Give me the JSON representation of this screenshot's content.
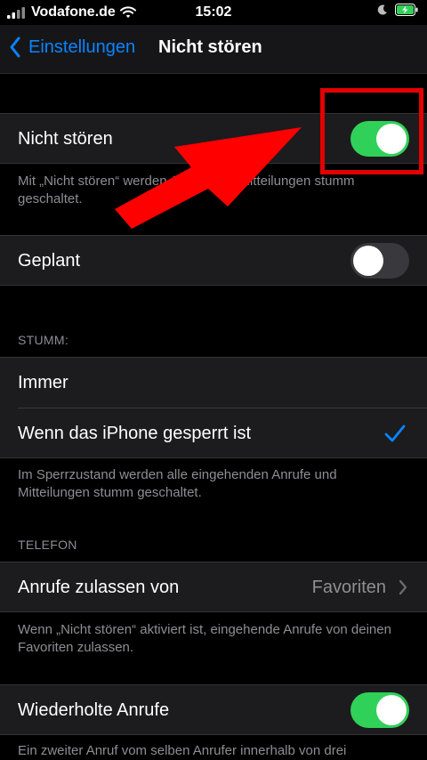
{
  "status_bar": {
    "carrier": "Vodafone.de",
    "time": "15:02"
  },
  "nav": {
    "back_label": "Einstellungen",
    "title": "Nicht stören"
  },
  "dnd": {
    "label": "Nicht stören",
    "enabled": true,
    "footer": "Mit „Nicht stören“ werden Anrufe und Mitteilungen stumm geschaltet."
  },
  "scheduled": {
    "label": "Geplant",
    "enabled": false
  },
  "silence": {
    "header": "STUMM:",
    "options": [
      "Immer",
      "Wenn das iPhone gesperrt ist"
    ],
    "selected_index": 1,
    "footer": "Im Sperrzustand werden alle eingehenden Anrufe und Mitteilungen stumm geschaltet."
  },
  "phone": {
    "header": "TELEFON",
    "allow_calls_label": "Anrufe zulassen von",
    "allow_calls_value": "Favoriten",
    "footer": "Wenn „Nicht stören“ aktiviert ist, eingehende Anrufe von deinen Favoriten zulassen.",
    "repeated_calls_label": "Wiederholte Anrufe",
    "repeated_calls_enabled": true,
    "repeated_footer": "Ein zweiter Anruf vom selben Anrufer innerhalb von drei"
  },
  "colors": {
    "accent": "#0a84ff",
    "toggle_on": "#30d158",
    "annotation": "#e30000"
  },
  "icons": [
    "signal-bars-icon",
    "wifi-icon",
    "moon-icon",
    "battery-charging-icon",
    "chevron-left-icon",
    "checkmark-icon",
    "chevron-right-icon",
    "annotation-arrow"
  ]
}
